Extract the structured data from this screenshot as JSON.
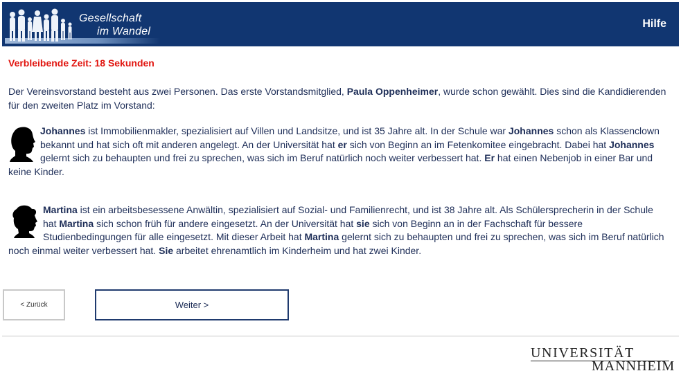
{
  "header": {
    "logo_line1": "Gesellschaft",
    "logo_line2": "im Wandel",
    "help_label": "Hilfe",
    "background_color": "#113671"
  },
  "timer": {
    "text": "Verbleibende Zeit: 18 Sekunden",
    "color": "#e1150f"
  },
  "intro": {
    "before": "Der Vereinsvorstand besteht aus zwei Personen. Das erste Vorstandsmitglied, ",
    "name": "Paula Oppenheimer",
    "after": ", wurde schon gewählt. Dies sind die Kandidierenden für den zweiten Platz im Vorstand:"
  },
  "candidates": [
    {
      "icon": "male-silhouette-icon",
      "name": "Johannes",
      "t1": " ist Immobilienmakler, spezialisiert auf Villen und Landsitze, und ist 35 Jahre alt. In der Schule war ",
      "t2": " schon als Klassenclown bekannt und hat sich oft mit anderen angelegt. An der Universität hat ",
      "pronoun": "er",
      "t3": " sich von Beginn an im Fetenkomitee eingebracht. Dabei hat ",
      "t4": " gelernt sich zu behaupten und frei zu sprechen, was sich im Beruf natürlich noch weiter verbessert hat. ",
      "pronoun_cap": "Er",
      "t5": " hat einen Nebenjob in einer Bar und keine Kinder."
    },
    {
      "icon": "female-silhouette-icon",
      "name": "Martina",
      "t1": " ist ein arbeitsbesessene Anwältin, spezialisiert auf Sozial- und Familienrecht, und ist 38 Jahre alt. Als Schülersprecherin in der Schule hat ",
      "t2": " sich schon früh für andere eingesetzt. An der Universität hat ",
      "pronoun": "sie",
      "t3": " sich von Beginn an in der Fachschaft für bessere Studienbedingungen für alle eingesetzt. Mit dieser Arbeit hat ",
      "t4": " gelernt sich zu behaupten und frei zu sprechen, was sich im Beruf natürlich noch einmal weiter verbessert hat. ",
      "pronoun_cap": "Sie",
      "t5": " arbeitet ehrenamtlich im Kinderheim und hat zwei Kinder."
    }
  ],
  "nav": {
    "back_label": "< Zurück",
    "next_label": "Weiter >"
  },
  "footer": {
    "uni_line1": "UNIVERSITÄT",
    "uni_line2": "MANNHEIM"
  }
}
